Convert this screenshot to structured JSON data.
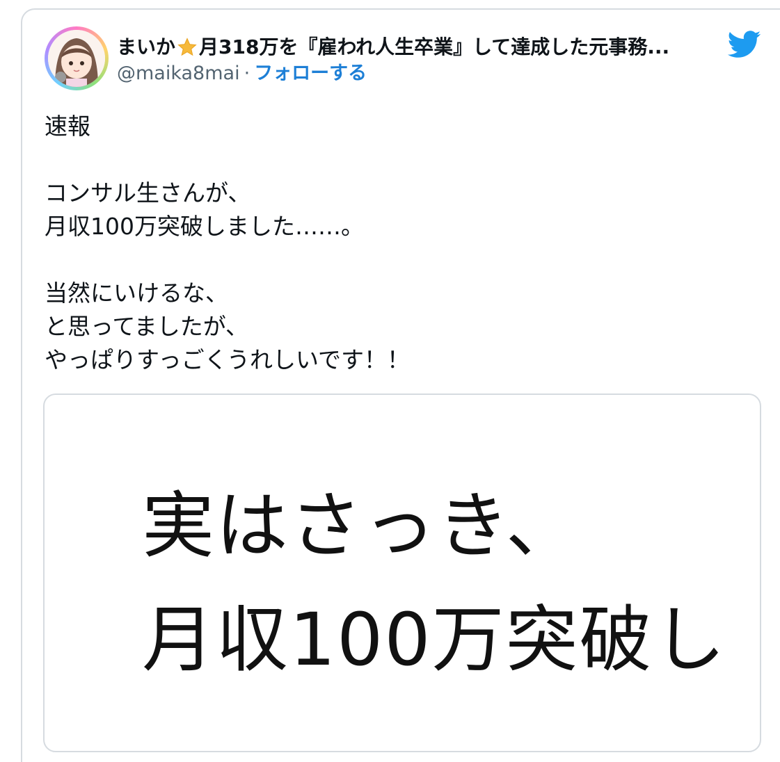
{
  "tweet": {
    "display_name": {
      "before_star": "まいか",
      "after_star": "月318万を『雇われ人生卒業』して達成した元事務..."
    },
    "handle": "@maika8mai",
    "separator": "·",
    "follow_label": "フォローする",
    "text": "速報\n\nコンサル生さんが、\n月収100万突破しました……。\n\n当然にいけるな、\nと思ってましたが、\nやっぱりすっごくうれしいです！！",
    "media": {
      "line1": "実はさっき、",
      "line2": "月収100万突破し"
    }
  },
  "colors": {
    "link_blue": "#1d7fd6",
    "twitter_blue": "#1d9bf0",
    "star_gold": "#f6b93b",
    "secondary_text": "#536471",
    "border": "#d6dbe0"
  },
  "icons": {
    "star": "star-emoji-icon",
    "twitter": "twitter-bird-icon"
  }
}
